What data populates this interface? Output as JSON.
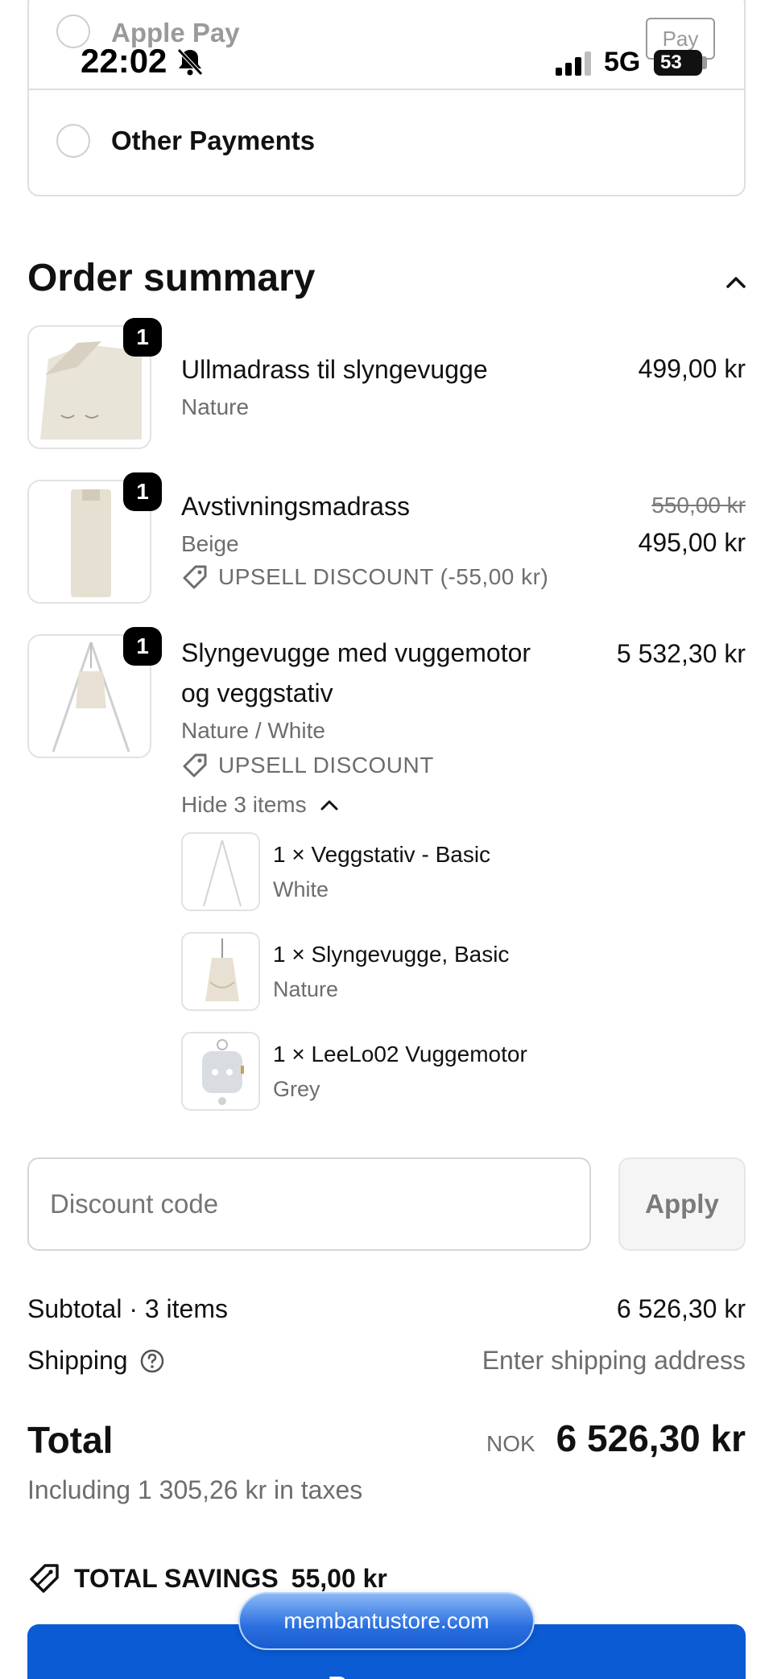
{
  "status_bar": {
    "time": "22:02",
    "network": "5G",
    "battery": "53"
  },
  "payment": {
    "apple_pay_label": "Apple Pay",
    "apple_pay_mark": "Pay",
    "other_label": "Other Payments"
  },
  "order_summary": {
    "title": "Order summary",
    "items": [
      {
        "qty": "1",
        "name": "Ullmadrass til slyngevugge",
        "variant": "Nature",
        "price": "499,00 kr"
      },
      {
        "qty": "1",
        "name": "Avstivningsmadrass",
        "variant": "Beige",
        "old_price": "550,00 kr",
        "price": "495,00 kr",
        "discount": "UPSELL DISCOUNT (-55,00 kr)"
      },
      {
        "qty": "1",
        "name_line1": "Slyngevugge med vuggemotor",
        "name_line2": "og veggstativ",
        "variant": "Nature / White",
        "price": "5 532,30 kr",
        "discount": "UPSELL DISCOUNT"
      }
    ],
    "bundle_toggle": "Hide 3 items",
    "bundle_items": [
      {
        "name": "1 × Veggstativ - Basic",
        "variant": "White"
      },
      {
        "name": "1 × Slyngevugge, Basic",
        "variant": "Nature"
      },
      {
        "name": "1 × LeeLo02 Vuggemotor",
        "variant": "Grey"
      }
    ]
  },
  "discount": {
    "placeholder": "Discount code",
    "apply_label": "Apply"
  },
  "totals": {
    "subtotal_label": "Subtotal · 3 items",
    "subtotal_value": "6 526,30 kr",
    "shipping_label": "Shipping",
    "shipping_value": "Enter shipping address",
    "total_label": "Total",
    "currency": "NOK",
    "total_value": "6 526,30 kr",
    "tax_note": "Including 1 305,26 kr in taxes",
    "savings_label": "TOTAL SAVINGS",
    "savings_value": "55,00 kr"
  },
  "pay_button": "Pay now",
  "browser_url": "membantustore.com"
}
